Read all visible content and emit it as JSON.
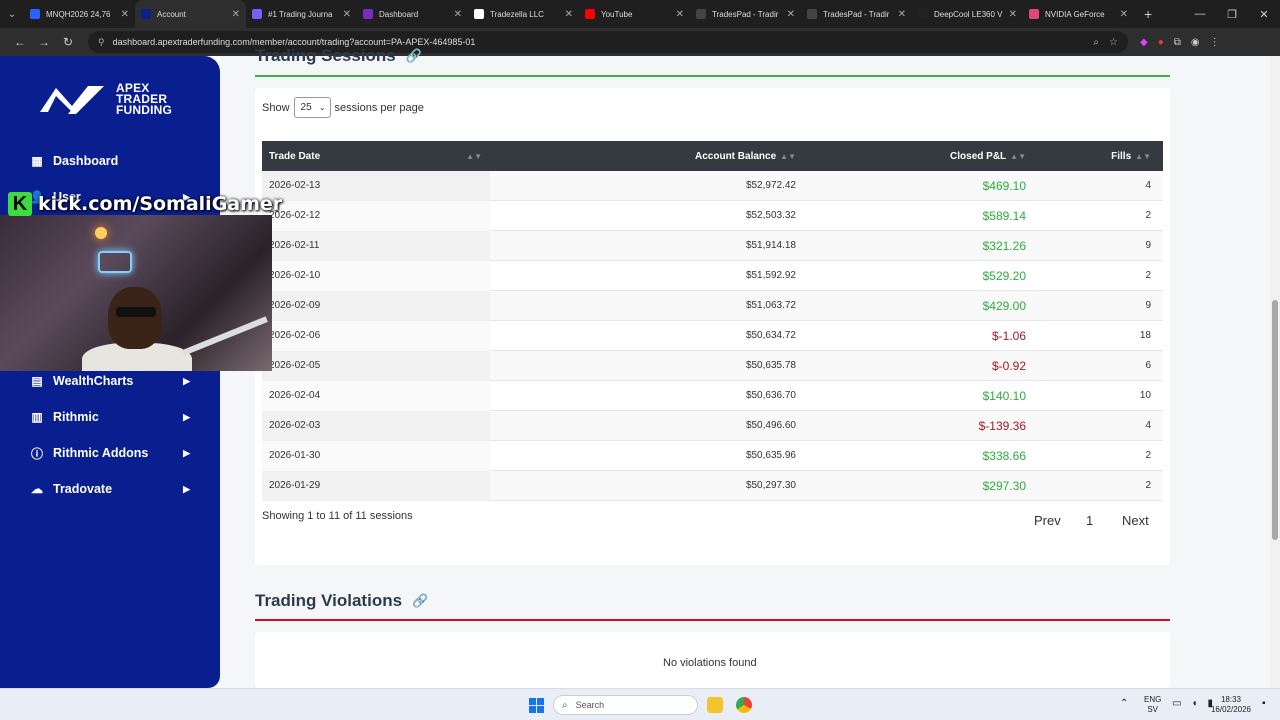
{
  "browser": {
    "tabs": [
      {
        "label": "MNQH2026 24,76",
        "color": "#2962ff",
        "active": false
      },
      {
        "label": "Account",
        "color": "#0a1f8f",
        "active": true
      },
      {
        "label": "#1 Trading Journa",
        "color": "#7a5cff",
        "active": false
      },
      {
        "label": "Dashboard",
        "color": "#7b2cbf",
        "active": false
      },
      {
        "label": "Tradezella LLC",
        "color": "#ffffff",
        "active": false
      },
      {
        "label": "YouTube",
        "color": "#ff0000",
        "active": false
      },
      {
        "label": "TradesPad - Tradir",
        "color": "#444444",
        "active": false
      },
      {
        "label": "TradesPad - Tradir",
        "color": "#444444",
        "active": false
      },
      {
        "label": "DeepCool LE360 V",
        "color": "#222222",
        "active": false
      },
      {
        "label": "NVIDIA GeForce",
        "color": "#e0457b",
        "active": false
      }
    ],
    "url": "dashboard.apextraderfunding.com/member/account/trading?account=PA-APEX-464985-01"
  },
  "sidebar": {
    "logo_text": [
      "APEX",
      "TRADER",
      "FUNDING"
    ],
    "items": [
      {
        "label": "Dashboard",
        "icon": "grid-icon",
        "arrow": false
      },
      {
        "label": "User",
        "icon": "user-icon",
        "arrow": true
      },
      {
        "label": "WealthCharts",
        "icon": "chart-icon",
        "arrow": true
      },
      {
        "label": "Rithmic",
        "icon": "calculator-icon",
        "arrow": true
      },
      {
        "label": "Rithmic Addons",
        "icon": "info-icon",
        "arrow": true
      },
      {
        "label": "Tradovate",
        "icon": "cloud-icon",
        "arrow": true
      }
    ]
  },
  "overlay": {
    "kick_handle": "kick.com/SomaliGamer",
    "kick_letter": "K"
  },
  "sessions": {
    "title": "Trading Sessions",
    "show_label": "Show",
    "per_page_value": "25",
    "per_page_suffix": "sessions per page",
    "columns": [
      "Trade Date",
      "Account Balance",
      "Closed P&L",
      "Fills"
    ],
    "rows": [
      {
        "date": "2026-02-13",
        "balance": "$52,972.42",
        "pnl": "$469.10",
        "fills": "4",
        "neg": false
      },
      {
        "date": "2026-02-12",
        "balance": "$52,503.32",
        "pnl": "$589.14",
        "fills": "2",
        "neg": false
      },
      {
        "date": "2026-02-11",
        "balance": "$51,914.18",
        "pnl": "$321.26",
        "fills": "9",
        "neg": false
      },
      {
        "date": "2026-02-10",
        "balance": "$51,592.92",
        "pnl": "$529.20",
        "fills": "2",
        "neg": false
      },
      {
        "date": "2026-02-09",
        "balance": "$51,063.72",
        "pnl": "$429.00",
        "fills": "9",
        "neg": false
      },
      {
        "date": "2026-02-06",
        "balance": "$50,634.72",
        "pnl": "$-1.06",
        "fills": "18",
        "neg": true
      },
      {
        "date": "2026-02-05",
        "balance": "$50,635.78",
        "pnl": "$-0.92",
        "fills": "6",
        "neg": true
      },
      {
        "date": "2026-02-04",
        "balance": "$50,636.70",
        "pnl": "$140.10",
        "fills": "10",
        "neg": false
      },
      {
        "date": "2026-02-03",
        "balance": "$50,496.60",
        "pnl": "$-139.36",
        "fills": "4",
        "neg": true
      },
      {
        "date": "2026-01-30",
        "balance": "$50,635.96",
        "pnl": "$338.66",
        "fills": "2",
        "neg": false
      },
      {
        "date": "2026-01-29",
        "balance": "$50,297.30",
        "pnl": "$297.30",
        "fills": "2",
        "neg": false
      }
    ],
    "showing_text": "Showing 1 to 11 of 11 sessions",
    "pager": {
      "prev": "Prev",
      "page": "1",
      "next": "Next"
    }
  },
  "violations": {
    "title": "Trading Violations",
    "empty_text": "No violations found"
  },
  "taskbar": {
    "search_placeholder": "Search",
    "lang_top": "ENG",
    "lang_bottom": "SV",
    "time": "18:33",
    "date": "16/02/2026"
  }
}
